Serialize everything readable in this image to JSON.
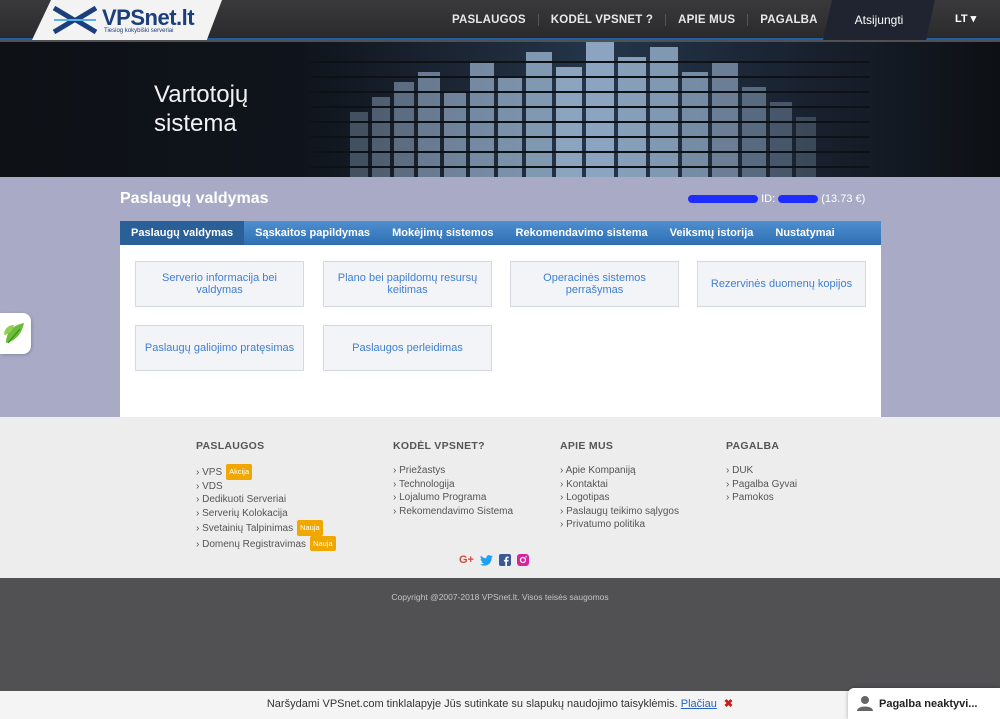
{
  "header": {
    "logo_text": "VPSnet.lt",
    "logo_tagline": "Tiesiog kokybiški serveriai",
    "nav": [
      "PASLAUGOS",
      "KODĖL VPSNET ?",
      "APIE MUS",
      "PAGALBA"
    ],
    "logout": "Atsijungti",
    "lang": "LT ▾"
  },
  "banner": {
    "title_line1": "Vartotojų",
    "title_line2": "sistema"
  },
  "page": {
    "title": "Paslaugų valdymas",
    "id_label": "ID:",
    "balance": "(13.73 €)",
    "tabs": [
      "Paslaugų valdymas",
      "Sąskaitos papildymas",
      "Mokėjimų sistemos",
      "Rekomendavimo sistema",
      "Veiksmų istorija",
      "Nustatymai"
    ],
    "cards": [
      "Serverio informacija bei valdymas",
      "Plano bei papildomų resursų keitimas",
      "Operacinės sistemos perrašymas",
      "Rezervinės duomenų kopijos",
      "Paslaugų galiojimo pratęsimas",
      "Paslaugos perleidimas"
    ]
  },
  "footer": {
    "col1": {
      "head": "PASLAUGOS",
      "items": [
        "VPS",
        "VDS",
        "Dedikuoti Serveriai",
        "Serverių Kolokacija",
        "Svetainių Talpinimas",
        "Domenų Registravimas"
      ],
      "badge_akcija": "Akcija",
      "badge_nauja": "Nauja"
    },
    "col2": {
      "head": "KODĖL VPSNET?",
      "items": [
        "Priežastys",
        "Technologija",
        "Lojalumo Programa",
        "Rekomendavimo Sistema"
      ]
    },
    "col3": {
      "head": "APIE MUS",
      "items": [
        "Apie Kompaniją",
        "Kontaktai",
        "Logotipas",
        "Paslaugų teikimo sąlygos",
        "Privatumo politika"
      ]
    },
    "col4": {
      "head": "PAGALBA",
      "items": [
        "DUK",
        "Pagalba Gyvai",
        "Pamokos"
      ]
    },
    "social_icons": [
      "google-plus-icon",
      "twitter-icon",
      "facebook-icon",
      "instagram-icon"
    ],
    "social_google": "G+",
    "copyright": "Copyright @2007-2018 VPSnet.lt. Visos teisės saugomos"
  },
  "cookie": {
    "text": "Naršydami VPSnet.com tinklalapyje Jūs sutinkate su slapukų naudojimo taisyklėmis.",
    "link": "Plačiau",
    "close": "✖"
  },
  "chat": {
    "label": "Pagalba neaktyvi..."
  },
  "colors": {
    "accent": "#3f7fd0",
    "tab_bar": "#2e6fb3",
    "main_bg": "#a9abc6",
    "badge": "#f0a800"
  }
}
